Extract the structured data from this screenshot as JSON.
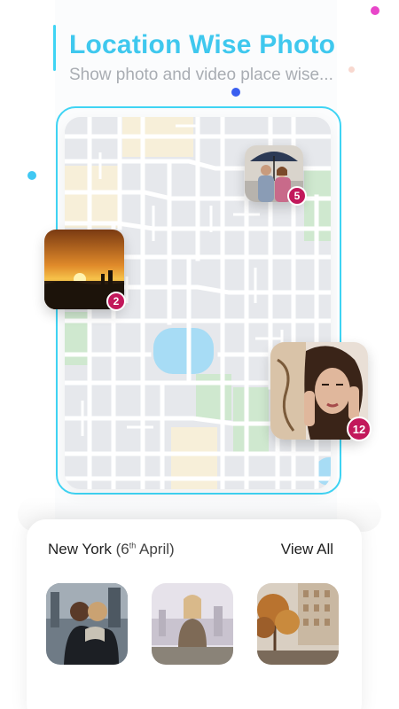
{
  "header": {
    "title": "Location Wise Photo",
    "subtitle": "Show photo and video place wise..."
  },
  "map": {
    "pins": [
      {
        "name": "couple-umbrella",
        "count": "5"
      },
      {
        "name": "sunset",
        "count": "2"
      },
      {
        "name": "woman-portrait",
        "count": "12"
      }
    ]
  },
  "panel": {
    "location": "New York",
    "date_prefix": "(6",
    "date_sup": "th",
    "date_suffix": " April)",
    "view_all": "View All",
    "thumbnails": [
      "friends-city",
      "woman-city-view",
      "autumn-street"
    ]
  },
  "colors": {
    "accent": "#3fc8ee",
    "badge": "#c2185b",
    "map_block": "#e6e8ec",
    "map_road": "#ffffff",
    "map_park": "#cfe8cf",
    "map_water": "#a7dcf5",
    "map_sand": "#f7efd9"
  }
}
